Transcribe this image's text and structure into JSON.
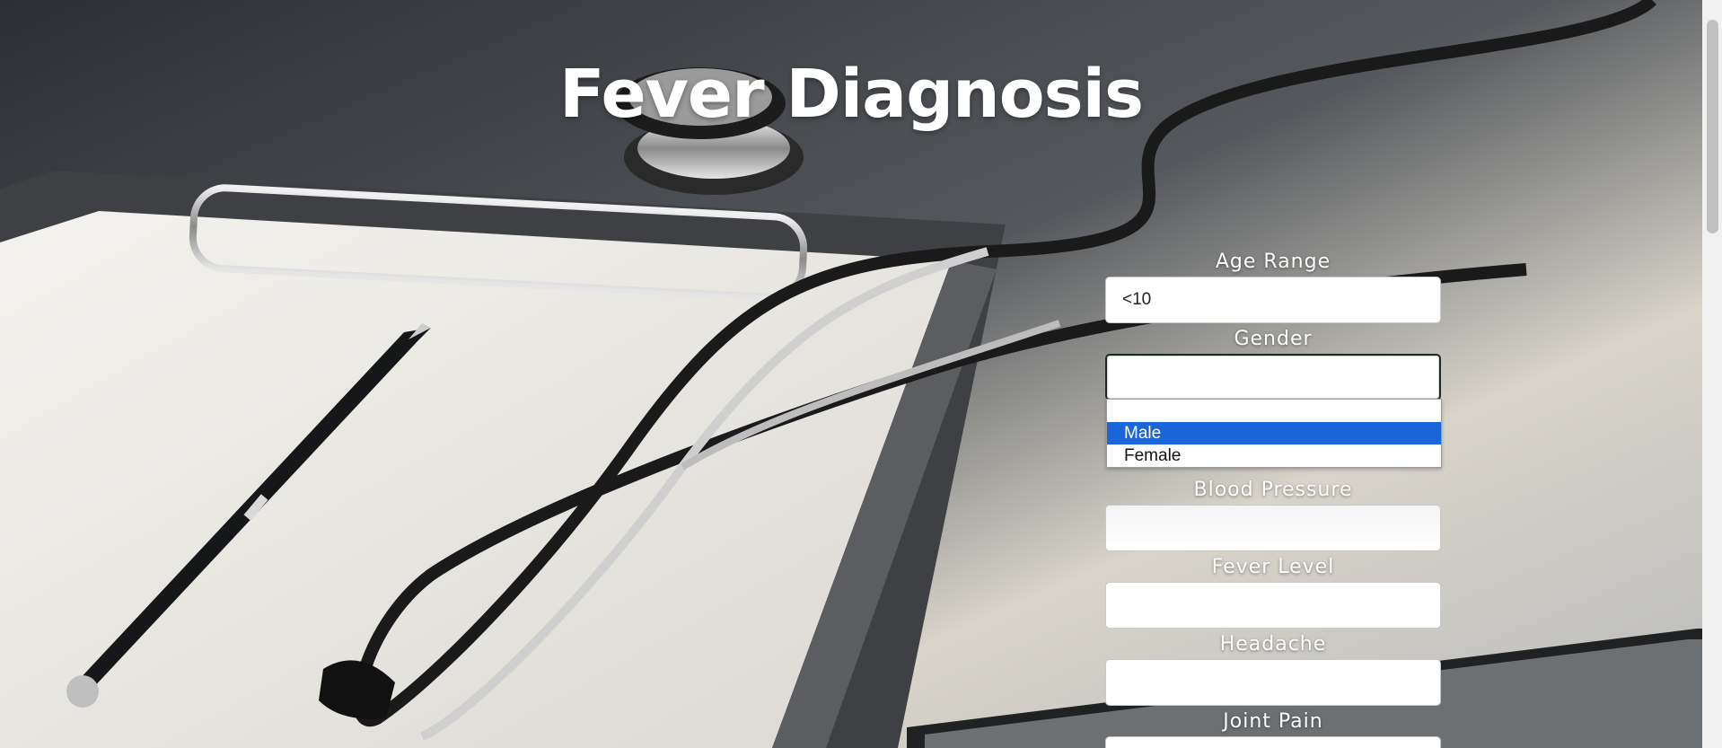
{
  "page": {
    "title": "Fever Diagnosis"
  },
  "form": {
    "fields": [
      {
        "label": "Age Range",
        "value": "<10"
      },
      {
        "label": "Gender",
        "value": ""
      },
      {
        "label": "Blood Pressure",
        "value": ""
      },
      {
        "label": "Fever Level",
        "value": ""
      },
      {
        "label": "Headache",
        "value": ""
      },
      {
        "label": "Joint Pain",
        "value": ""
      }
    ],
    "gender_dropdown": {
      "options": [
        "",
        "Male",
        "Female"
      ],
      "highlighted": "Male"
    }
  },
  "colors": {
    "dropdown_highlight": "#1a66d9",
    "label_text": "#ffffff"
  }
}
